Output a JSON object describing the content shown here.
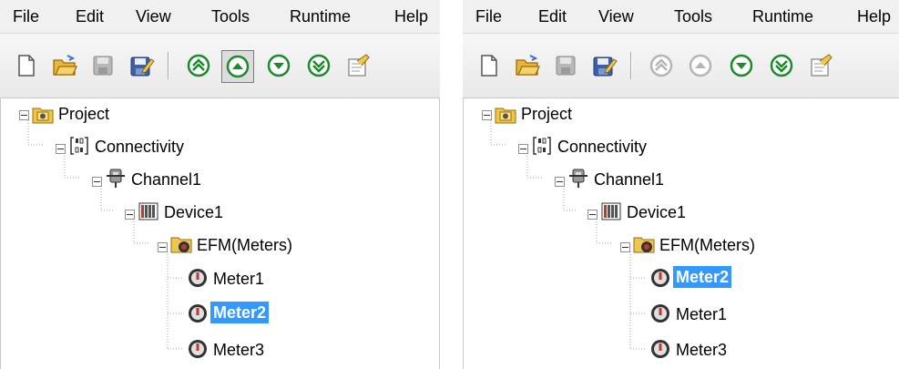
{
  "menu": [
    "File",
    "Edit",
    "View",
    "Tools",
    "Runtime",
    "Help"
  ],
  "menu_right_visible_help": "Help",
  "toolbar": {
    "icons": [
      "new-document-icon",
      "open-folder-icon",
      "save-icon",
      "save-as-icon",
      "move-to-top-icon",
      "move-up-icon",
      "move-down-icon",
      "move-to-bottom-icon",
      "properties-icon"
    ]
  },
  "left": {
    "tree": {
      "project": "Project",
      "connectivity": "Connectivity",
      "channel": "Channel1",
      "device": "Device1",
      "efm": "EFM(Meters)",
      "meters": [
        "Meter1",
        "Meter2",
        "Meter3"
      ],
      "selected": "Meter2"
    }
  },
  "right": {
    "tree": {
      "project": "Project",
      "connectivity": "Connectivity",
      "channel": "Channel1",
      "device": "Device1",
      "efm": "EFM(Meters)",
      "meters": [
        "Meter2",
        "Meter1",
        "Meter3"
      ],
      "selected": "Meter2"
    }
  },
  "colors": {
    "selection": "#3399ff",
    "menubar": "#f0f0f0",
    "up_down_green": "#1c8a2b"
  }
}
